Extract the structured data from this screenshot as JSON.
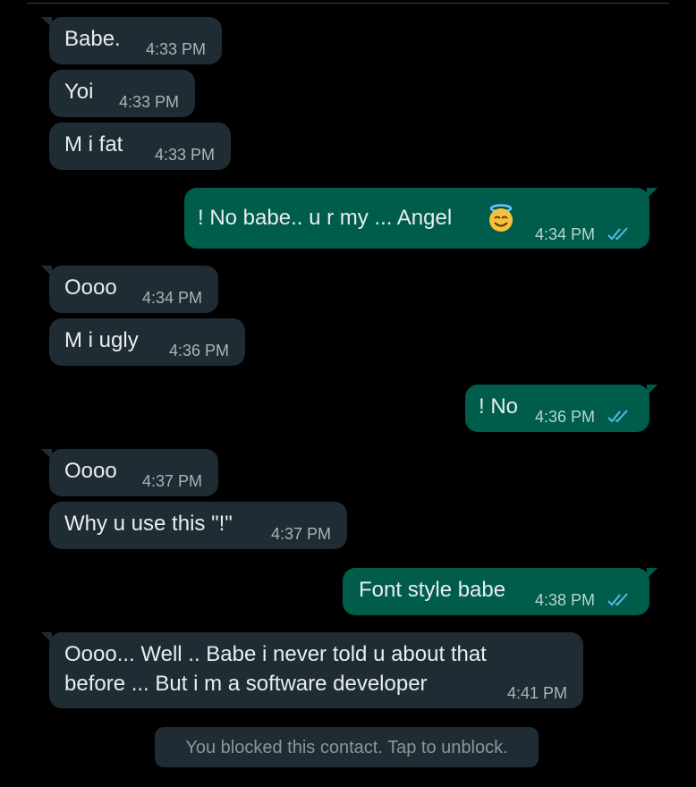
{
  "messages": [
    {
      "direction": "incoming",
      "text": "Babe.",
      "time": "4:33 PM"
    },
    {
      "direction": "incoming",
      "text": "Yoi",
      "time": "4:33 PM"
    },
    {
      "direction": "incoming",
      "text": "M i fat",
      "time": "4:33 PM"
    },
    {
      "direction": "outgoing",
      "text": "! No babe.. u r my ... Angel",
      "emoji": "smiling-face-with-halo",
      "time": "4:34 PM",
      "status": "read"
    },
    {
      "direction": "incoming",
      "text": "Oooo",
      "time": "4:34 PM"
    },
    {
      "direction": "incoming",
      "text": "M i ugly",
      "time": "4:36 PM"
    },
    {
      "direction": "outgoing",
      "text": "! No",
      "time": "4:36 PM",
      "status": "read"
    },
    {
      "direction": "incoming",
      "text": "Oooo",
      "time": "4:37 PM"
    },
    {
      "direction": "incoming",
      "text": "Why u use this \"!\"",
      "time": "4:37 PM"
    },
    {
      "direction": "outgoing",
      "text": "Font style babe",
      "time": "4:38 PM",
      "status": "read"
    },
    {
      "direction": "incoming",
      "text_line1": "Oooo... Well ..  Babe i never told u about that",
      "text_line2": "before ... But i m a software developer",
      "time": "4:41 PM"
    }
  ],
  "system_notice": "You blocked this contact. Tap to unblock.",
  "colors": {
    "background": "#000000",
    "incoming_bubble": "#1f2c34",
    "outgoing_bubble": "#005c4b",
    "read_ticks": "#53bdeb",
    "timestamp": "#aab4ba"
  }
}
